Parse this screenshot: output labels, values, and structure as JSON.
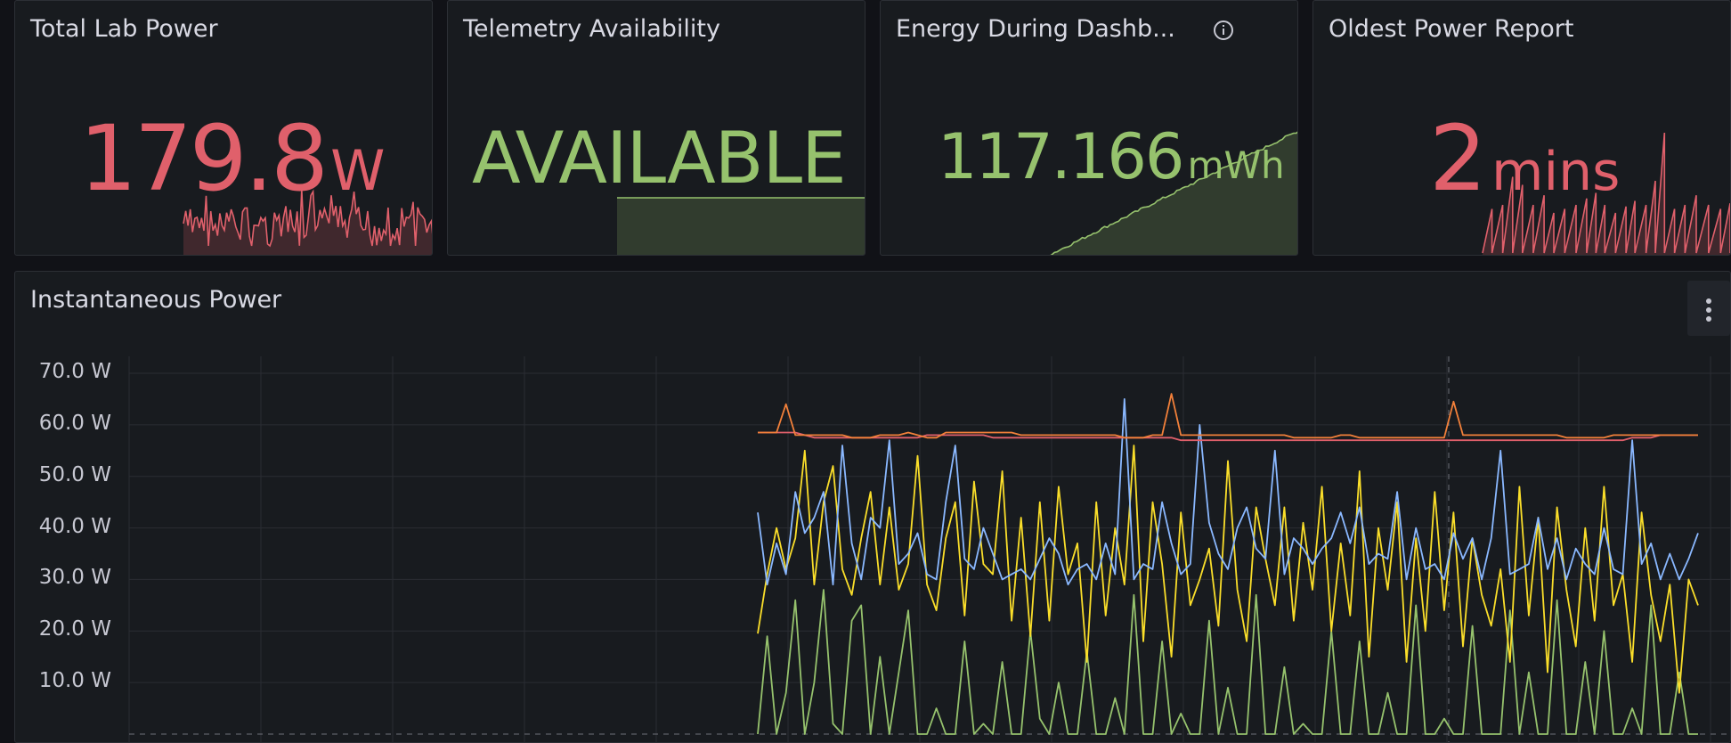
{
  "colors": {
    "red": "#e0606b",
    "green": "#96c26d",
    "blue": "#8ab8ff",
    "yellow": "#fade2a",
    "orange": "#f2803a",
    "bg": "#181b1f"
  },
  "panels": {
    "total_power": {
      "title": "Total Lab Power",
      "value": "179.8",
      "unit": "W"
    },
    "telemetry": {
      "title": "Telemetry Availability",
      "value": "AVAILABLE"
    },
    "energy": {
      "title": "Energy During Dashb...",
      "value": "117.166",
      "unit": "mWh",
      "icon": "info-icon"
    },
    "oldest": {
      "title": "Oldest Power Report",
      "value": "2",
      "unit": "mins"
    }
  },
  "chart": {
    "title": "Instantaneous Power",
    "menu_icon": "kebab-menu-icon",
    "chart_data": {
      "type": "line",
      "ylim": [
        0,
        70
      ],
      "y_ticks": [
        "70.0 W",
        "60.0 W",
        "50.0 W",
        "40.0 W",
        "30.0 W",
        "20.0 W",
        "10.0 W"
      ],
      "grid": true,
      "series": [
        {
          "color": "#f2803a",
          "values": [
            58.5,
            58.5,
            58.5,
            64,
            58,
            58,
            58,
            58,
            58,
            58,
            57.5,
            57.5,
            57.5,
            58,
            58,
            58,
            58.5,
            58,
            57.5,
            57.5,
            58.5,
            58.5,
            58.5,
            58.5,
            58.5,
            58.5,
            58.5,
            58.5,
            58,
            58,
            58,
            58,
            58,
            58,
            58,
            58,
            58,
            58,
            58,
            57.5,
            57.5,
            57.5,
            58,
            58,
            66,
            58,
            58,
            58,
            58,
            58,
            58,
            58,
            58,
            58,
            58,
            58,
            58,
            57.5,
            57.5,
            57.5,
            57.5,
            57.5,
            58,
            58,
            57.5,
            57.5,
            57.5,
            57.5,
            57.5,
            57.5,
            57.5,
            57.5,
            57.5,
            57.5,
            64.5,
            58,
            58,
            58,
            58,
            58,
            58,
            58,
            58,
            58,
            58,
            58,
            57.5,
            57.5,
            57.5,
            57.5,
            57.5,
            58,
            58,
            58,
            58,
            58,
            58,
            58,
            58,
            58,
            58
          ]
        },
        {
          "color": "#e0606b",
          "values": [
            58.5,
            58.5,
            58.5,
            58.5,
            58.5,
            58,
            57.5,
            57.5,
            57.5,
            57.5,
            57.5,
            57.5,
            57.5,
            57.5,
            57.5,
            57.5,
            57.5,
            57.5,
            58,
            58,
            58,
            58,
            58,
            58,
            58,
            57.5,
            57.5,
            57.5,
            57.5,
            57.5,
            57.5,
            57.5,
            57.5,
            57.5,
            57.5,
            57.5,
            57.5,
            57.5,
            57.5,
            57.5,
            57.5,
            57.5,
            57.5,
            57.5,
            57.5,
            57,
            57,
            57,
            57,
            57,
            57,
            57,
            57,
            57,
            57,
            57,
            57,
            57,
            57,
            57,
            57,
            57,
            57,
            57,
            57,
            57,
            57,
            57,
            57,
            57,
            57,
            57,
            57,
            57,
            57,
            57,
            57,
            57,
            57,
            57,
            57,
            57,
            57,
            57,
            57,
            57,
            57,
            57,
            57,
            57,
            57,
            57,
            57,
            57.5,
            57.5,
            57.5,
            58,
            58,
            58,
            58,
            58
          ]
        },
        {
          "color": "#8ab8ff",
          "values": [
            43,
            29,
            37,
            31,
            47,
            39,
            42,
            47,
            29,
            56,
            37,
            30,
            42,
            40,
            57,
            33,
            35,
            39,
            31,
            30,
            45,
            56,
            34,
            32,
            40,
            35,
            30,
            31,
            32,
            30,
            34,
            38,
            35,
            29,
            32,
            33,
            30,
            37,
            31,
            65,
            30,
            33,
            32,
            45,
            37,
            31,
            33,
            60,
            41,
            35,
            32,
            40,
            44,
            36,
            34,
            55,
            31,
            38,
            36,
            33,
            36,
            38,
            43,
            37,
            44,
            33,
            35,
            34,
            47,
            30,
            40,
            32,
            33,
            30,
            39,
            34,
            38,
            30,
            38,
            55,
            31,
            32,
            33,
            42,
            32,
            38,
            30,
            36,
            33,
            31,
            40,
            32,
            31,
            57,
            33,
            37,
            30,
            35,
            30,
            34,
            39
          ]
        },
        {
          "color": "#fade2a",
          "values": [
            19.5,
            31,
            40,
            32,
            38,
            55,
            29,
            45,
            52,
            32,
            27,
            38,
            47,
            29,
            44,
            28,
            33,
            54,
            29,
            24,
            38,
            45,
            23,
            49,
            33,
            31,
            51,
            22,
            42,
            19,
            45,
            22,
            48,
            31,
            37,
            14,
            45,
            23,
            40,
            29,
            56,
            18,
            45,
            33,
            15,
            43,
            25,
            30,
            36,
            21,
            53,
            28,
            18,
            44,
            34,
            25,
            44,
            22,
            41,
            28,
            48,
            20,
            37,
            23,
            51,
            15,
            40,
            28,
            45,
            14,
            38,
            20,
            47,
            24,
            43,
            17,
            38,
            27,
            21,
            32,
            14,
            48,
            23,
            42,
            12,
            44,
            28,
            17,
            40,
            22,
            48,
            25,
            31,
            14,
            43,
            27,
            18,
            29,
            8,
            30,
            25
          ]
        },
        {
          "color": "#96c26d",
          "values": [
            0,
            19,
            0,
            8,
            26,
            0,
            10,
            28,
            2,
            0,
            22,
            25,
            0,
            15,
            0,
            12,
            24,
            0,
            0,
            5,
            0,
            0,
            18,
            0,
            2,
            0,
            14,
            0,
            0,
            20,
            3,
            0,
            10,
            0,
            0,
            16,
            0,
            0,
            7,
            0,
            27,
            0,
            0,
            18,
            0,
            4,
            0,
            0,
            22,
            0,
            9,
            0,
            0,
            27,
            0,
            0,
            13,
            0,
            2,
            0,
            0,
            20,
            0,
            0,
            18,
            0,
            0,
            8,
            0,
            0,
            25,
            0,
            0,
            3,
            0,
            0,
            21,
            0,
            0,
            0,
            24,
            0,
            12,
            0,
            0,
            26,
            0,
            0,
            14,
            0,
            20,
            0,
            0,
            5,
            0,
            25,
            0,
            0,
            12,
            0,
            0
          ]
        }
      ]
    }
  }
}
